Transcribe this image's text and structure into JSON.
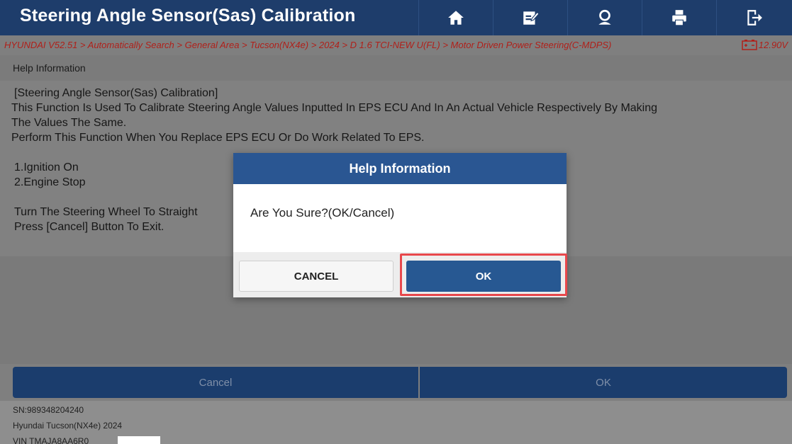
{
  "header": {
    "title": "Steering Angle Sensor(Sas) Calibration",
    "icons": [
      "home-icon",
      "edit-report-icon",
      "help-person-icon",
      "print-icon",
      "exit-icon"
    ]
  },
  "breadcrumb": {
    "path": "HYUNDAI V52.51 > Automatically Search > General Area > Tucson(NX4e) > 2024 > D 1.6 TCI-NEW U(FL) > Motor Driven Power Steering(C-MDPS)",
    "battery_voltage": "12.90V"
  },
  "section": {
    "title": "Help Information"
  },
  "content": {
    "lines": [
      "[Steering Angle Sensor(Sas) Calibration]",
      " This Function Is Used To Calibrate Steering Angle Values Inputted In EPS ECU And In An Actual Vehicle Respectively By Making",
      "The Values The Same.",
      " Perform This Function When You Replace EPS ECU Or Do Work Related To EPS.",
      "1.Ignition On",
      "2.Engine Stop",
      "Turn The Steering Wheel To Straight",
      "Press [Cancel] Button To Exit."
    ]
  },
  "bottom_buttons": {
    "cancel": "Cancel",
    "ok": "OK"
  },
  "footer": {
    "sn": "SN:989348204240",
    "vehicle": "Hyundai Tucson(NX4e) 2024",
    "vin": "VIN TMAJA8AA6R0"
  },
  "dialog": {
    "title": "Help Information",
    "message": "Are You Sure?(OK/Cancel)",
    "cancel_label": "CANCEL",
    "ok_label": "OK"
  },
  "colors": {
    "header_bg": "#1e3d6b",
    "dialog_header": "#2a5692",
    "ok_button": "#275892",
    "breadcrumb_text": "#b0201a",
    "highlight": "#e8484c"
  }
}
